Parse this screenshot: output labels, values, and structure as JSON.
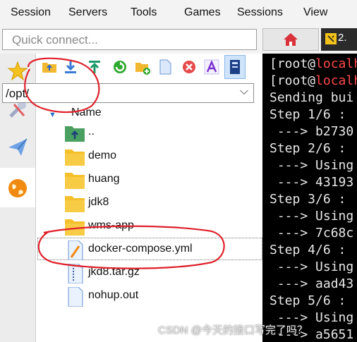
{
  "menubar": {
    "items": [
      "Session",
      "Servers",
      "Tools",
      "Games",
      "Sessions",
      "View"
    ]
  },
  "quick_connect": {
    "placeholder": "Quick connect..."
  },
  "tabs": {
    "home_icon": "home-icon",
    "terminal_label": "2."
  },
  "sidebar_tabs": [
    "star-icon",
    "tools-icon",
    "paper-plane-icon",
    "globe-icon"
  ],
  "sftp": {
    "toolbar_icons": [
      "open-folder-icon",
      "download-icon",
      "upload-icon",
      "refresh-icon",
      "new-folder-icon",
      "new-file-icon",
      "delete-icon",
      "rename-icon",
      "properties-icon"
    ],
    "path": "/opt/",
    "column_header": "Name",
    "entries": [
      {
        "name": "..",
        "type": "parent"
      },
      {
        "name": "demo",
        "type": "folder"
      },
      {
        "name": "huang",
        "type": "folder"
      },
      {
        "name": "jdk8",
        "type": "folder"
      },
      {
        "name": "wms-app",
        "type": "folder"
      },
      {
        "name": "docker-compose.yml",
        "type": "file-edit"
      },
      {
        "name": "jkd8.tar.gz",
        "type": "archive"
      },
      {
        "name": "nohup.out",
        "type": "file"
      }
    ]
  },
  "terminal": {
    "lines": [
      {
        "prefix": "[root@",
        "accent": "localh"
      },
      {
        "prefix": "[root@",
        "accent": "localh"
      },
      {
        "text": "Sending bui"
      },
      {
        "text": "Step 1/6 : "
      },
      {
        "text": " ---> b2730"
      },
      {
        "text": "Step 2/6 : "
      },
      {
        "text": " ---> Using"
      },
      {
        "text": " ---> 43193"
      },
      {
        "text": "Step 3/6 : "
      },
      {
        "text": " ---> Using"
      },
      {
        "text": " ---> 7c68c"
      },
      {
        "text": "Step 4/6 : "
      },
      {
        "text": " ---> Using"
      },
      {
        "text": " ---> aad43"
      },
      {
        "text": "Step 5/6 : "
      },
      {
        "text": " ---> Using"
      },
      {
        "text": " ---> a5651"
      }
    ]
  },
  "watermark": "CSDN @今天的接口写完了吗？",
  "colors": {
    "folder": "#f5c02b",
    "terminal_bg": "#000000",
    "annotation": "#e0202a"
  }
}
